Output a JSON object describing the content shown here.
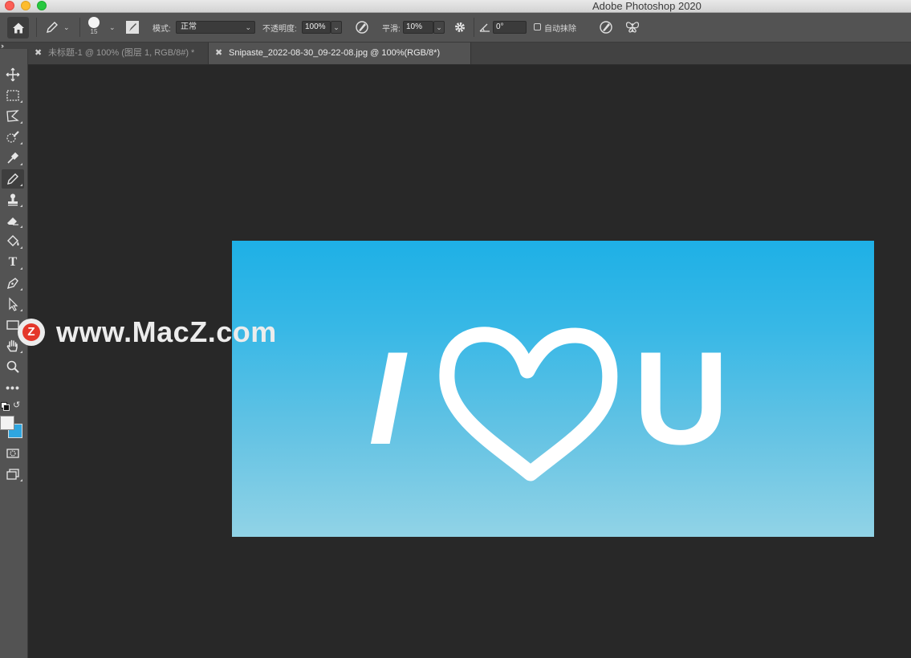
{
  "window": {
    "app_title": "Adobe Photoshop 2020"
  },
  "options_bar": {
    "brush_size": "15",
    "mode_label": "模式:",
    "mode_value": "正常",
    "opacity_label": "不透明度:",
    "opacity_value": "100%",
    "smoothing_label": "平滑:",
    "smoothing_value": "10%",
    "angle_value": "0°",
    "auto_erase_label": "自动抹除"
  },
  "tabs": [
    {
      "label": "未标题-1 @ 100% (图层 1, RGB/8#) *",
      "active": false
    },
    {
      "label": "Snipaste_2022-08-30_09-22-08.jpg @ 100%(RGB/8*)",
      "active": true
    }
  ],
  "toolbar": {
    "tools": [
      "move-tool",
      "marquee-tool",
      "lasso-tool",
      "quick-selection-tool",
      "eyedropper-tool",
      "pencil-tool",
      "clone-stamp-tool",
      "eraser-tool",
      "paint-bucket-tool",
      "type-tool",
      "pen-tool",
      "path-selection-tool",
      "rectangle-tool",
      "hand-tool",
      "zoom-tool",
      "more-tools"
    ],
    "type_tool_glyph": "T",
    "more_glyph": "•••",
    "selected_tool": "pencil-tool",
    "foreground_color": "#f2f2f2",
    "background_color": "#2fa6e0"
  },
  "canvas": {
    "image_text": {
      "letter_i": "I",
      "letter_u": "U"
    }
  },
  "watermark": {
    "logo_letter": "Z",
    "text": "www.MacZ.com"
  }
}
